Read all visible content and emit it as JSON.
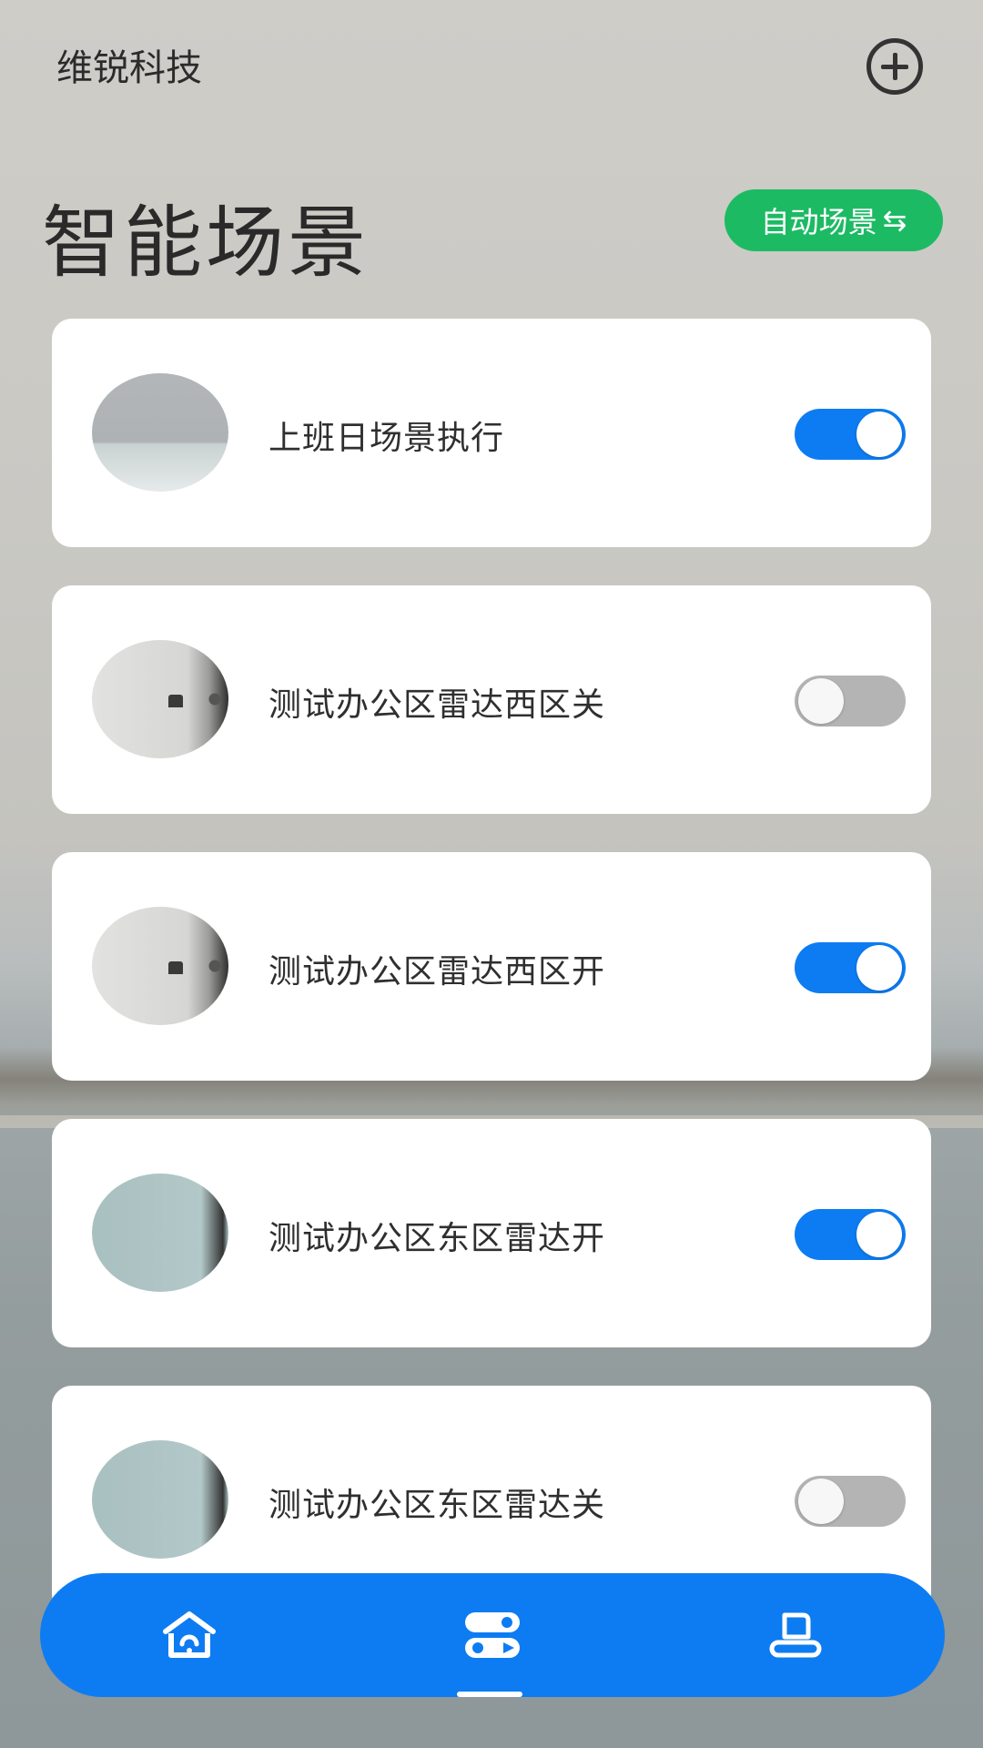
{
  "app": {
    "name": "维锐科技"
  },
  "header": {
    "title": "智能场景",
    "auto_scene_label": "自动场景",
    "auto_scene_icon": "swap-arrows-icon",
    "add_icon": "plus-circle-icon"
  },
  "scenes": [
    {
      "label": "上班日场景执行",
      "enabled": true
    },
    {
      "label": "测试办公区雷达西区关",
      "enabled": false
    },
    {
      "label": "测试办公区雷达西区开",
      "enabled": true
    },
    {
      "label": "测试办公区东区雷达开",
      "enabled": true
    },
    {
      "label": "测试办公区东区雷达关",
      "enabled": false
    }
  ],
  "tabbar": {
    "tabs": [
      {
        "icon": "home-icon",
        "active": false
      },
      {
        "icon": "scene-toggle-icon",
        "active": true
      },
      {
        "icon": "profile-icon",
        "active": false
      }
    ]
  },
  "colors": {
    "accent": "#0d7cf2",
    "auto_pill": "#1dba64",
    "toggle_off": "#b4b4b4"
  }
}
